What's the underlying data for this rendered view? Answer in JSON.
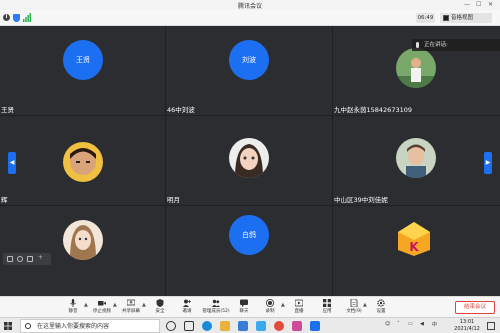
{
  "window": {
    "title": "腾讯会议"
  },
  "infobar": {
    "time": "06:49",
    "view_label": "音格视图"
  },
  "speaking": {
    "label": "正在讲话:"
  },
  "tiles": [
    {
      "name": "王贤",
      "avatar_text": "王贤"
    },
    {
      "name": "46中刘波",
      "avatar_text": "刘波"
    },
    {
      "name": "九中赵永茵15842673109"
    },
    {
      "name": "辉"
    },
    {
      "name": "明月"
    },
    {
      "name": "中山区39中刘佳妮"
    },
    {
      "name": ""
    },
    {
      "name": "",
      "avatar_text": "白鸽"
    },
    {
      "name": ""
    }
  ],
  "toolbar": {
    "mute": "静音",
    "video": "停止视频",
    "share": "共享屏幕",
    "security": "安全",
    "invite": "邀请",
    "members": "管理成员(52)",
    "chat": "聊天",
    "record": "录制",
    "live": "直播",
    "apps": "应用",
    "docs": "文档(9)",
    "settings": "设置",
    "end": "结束会议"
  },
  "taskbar": {
    "search_placeholder": "在这里输入你要搜索的内容",
    "time": "13:01",
    "date": "2021/4/12",
    "lang": "中"
  },
  "colors": {
    "accent": "#1d6ff2",
    "danger": "#e0433b"
  }
}
